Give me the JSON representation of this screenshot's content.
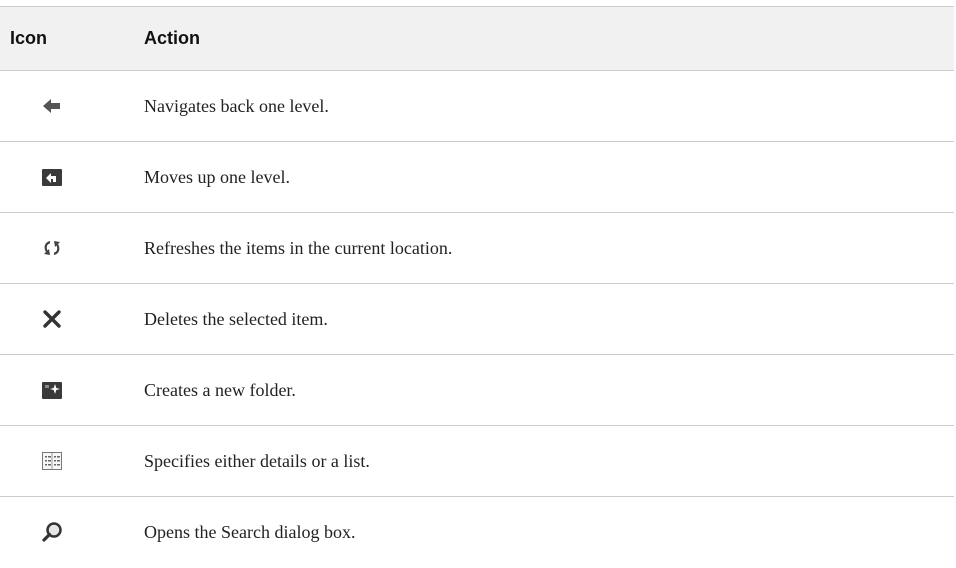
{
  "table": {
    "headers": {
      "icon": "Icon",
      "action": "Action"
    },
    "rows": [
      {
        "icon": "back-arrow-icon",
        "action": "Navigates back one level."
      },
      {
        "icon": "up-folder-icon",
        "action": "Moves up one level."
      },
      {
        "icon": "refresh-icon",
        "action": "Refreshes the items in the current location."
      },
      {
        "icon": "delete-x-icon",
        "action": "Deletes the selected item."
      },
      {
        "icon": "new-folder-icon",
        "action": "Creates a new folder."
      },
      {
        "icon": "details-list-icon",
        "action": "Specifies either details or a list."
      },
      {
        "icon": "search-magnifier-icon",
        "action": "Opens the Search dialog box."
      }
    ]
  },
  "colors": {
    "header_background": "#f1f1f1",
    "rule": "#cccccc",
    "icon_dark": "#444444"
  }
}
